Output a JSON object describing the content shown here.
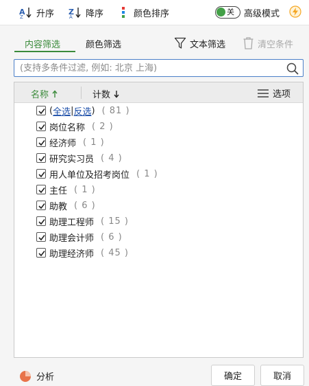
{
  "toolbar": {
    "sort_asc_label": "升序",
    "sort_desc_label": "降序",
    "color_sort_label": "颜色排序",
    "toggle_state_label": "关",
    "advanced_mode_label": "高级模式"
  },
  "tabs": {
    "content_filter": "内容筛选",
    "color_filter": "颜色筛选"
  },
  "actions": {
    "text_filter": "文本筛选",
    "clear_conditions": "清空条件"
  },
  "search": {
    "placeholder": "(支持多条件过滤, 例如: 北京 上海)"
  },
  "list_header": {
    "name_label": "名称",
    "count_label": "计数",
    "options_label": "选项"
  },
  "select_all": {
    "all_label": "全选",
    "separator": "|",
    "invert_label": "反选",
    "count_text": "( 81 )"
  },
  "items": [
    {
      "label": "岗位名称",
      "count_text": "( 2 )",
      "checked": true
    },
    {
      "label": "经济师",
      "count_text": "( 1 )",
      "checked": true
    },
    {
      "label": "研究实习员",
      "count_text": "( 4 )",
      "checked": true
    },
    {
      "label": "用人单位及招考岗位",
      "count_text": "( 1 )",
      "checked": true
    },
    {
      "label": "主任",
      "count_text": "( 1 )",
      "checked": true
    },
    {
      "label": "助教",
      "count_text": "( 6 )",
      "checked": true
    },
    {
      "label": "助理工程师",
      "count_text": "( 15 )",
      "checked": true
    },
    {
      "label": "助理会计师",
      "count_text": "( 6 )",
      "checked": true
    },
    {
      "label": "助理经济师",
      "count_text": "( 45 )",
      "checked": true
    }
  ],
  "footer": {
    "analyze_label": "分析",
    "ok_label": "确定",
    "cancel_label": "取消"
  },
  "colors": {
    "accent_green": "#3a8a3a",
    "link_blue": "#1a4da8",
    "search_border": "#4a7fc8",
    "bolt_orange": "#f5a623",
    "pie_orange": "#e8734a"
  }
}
